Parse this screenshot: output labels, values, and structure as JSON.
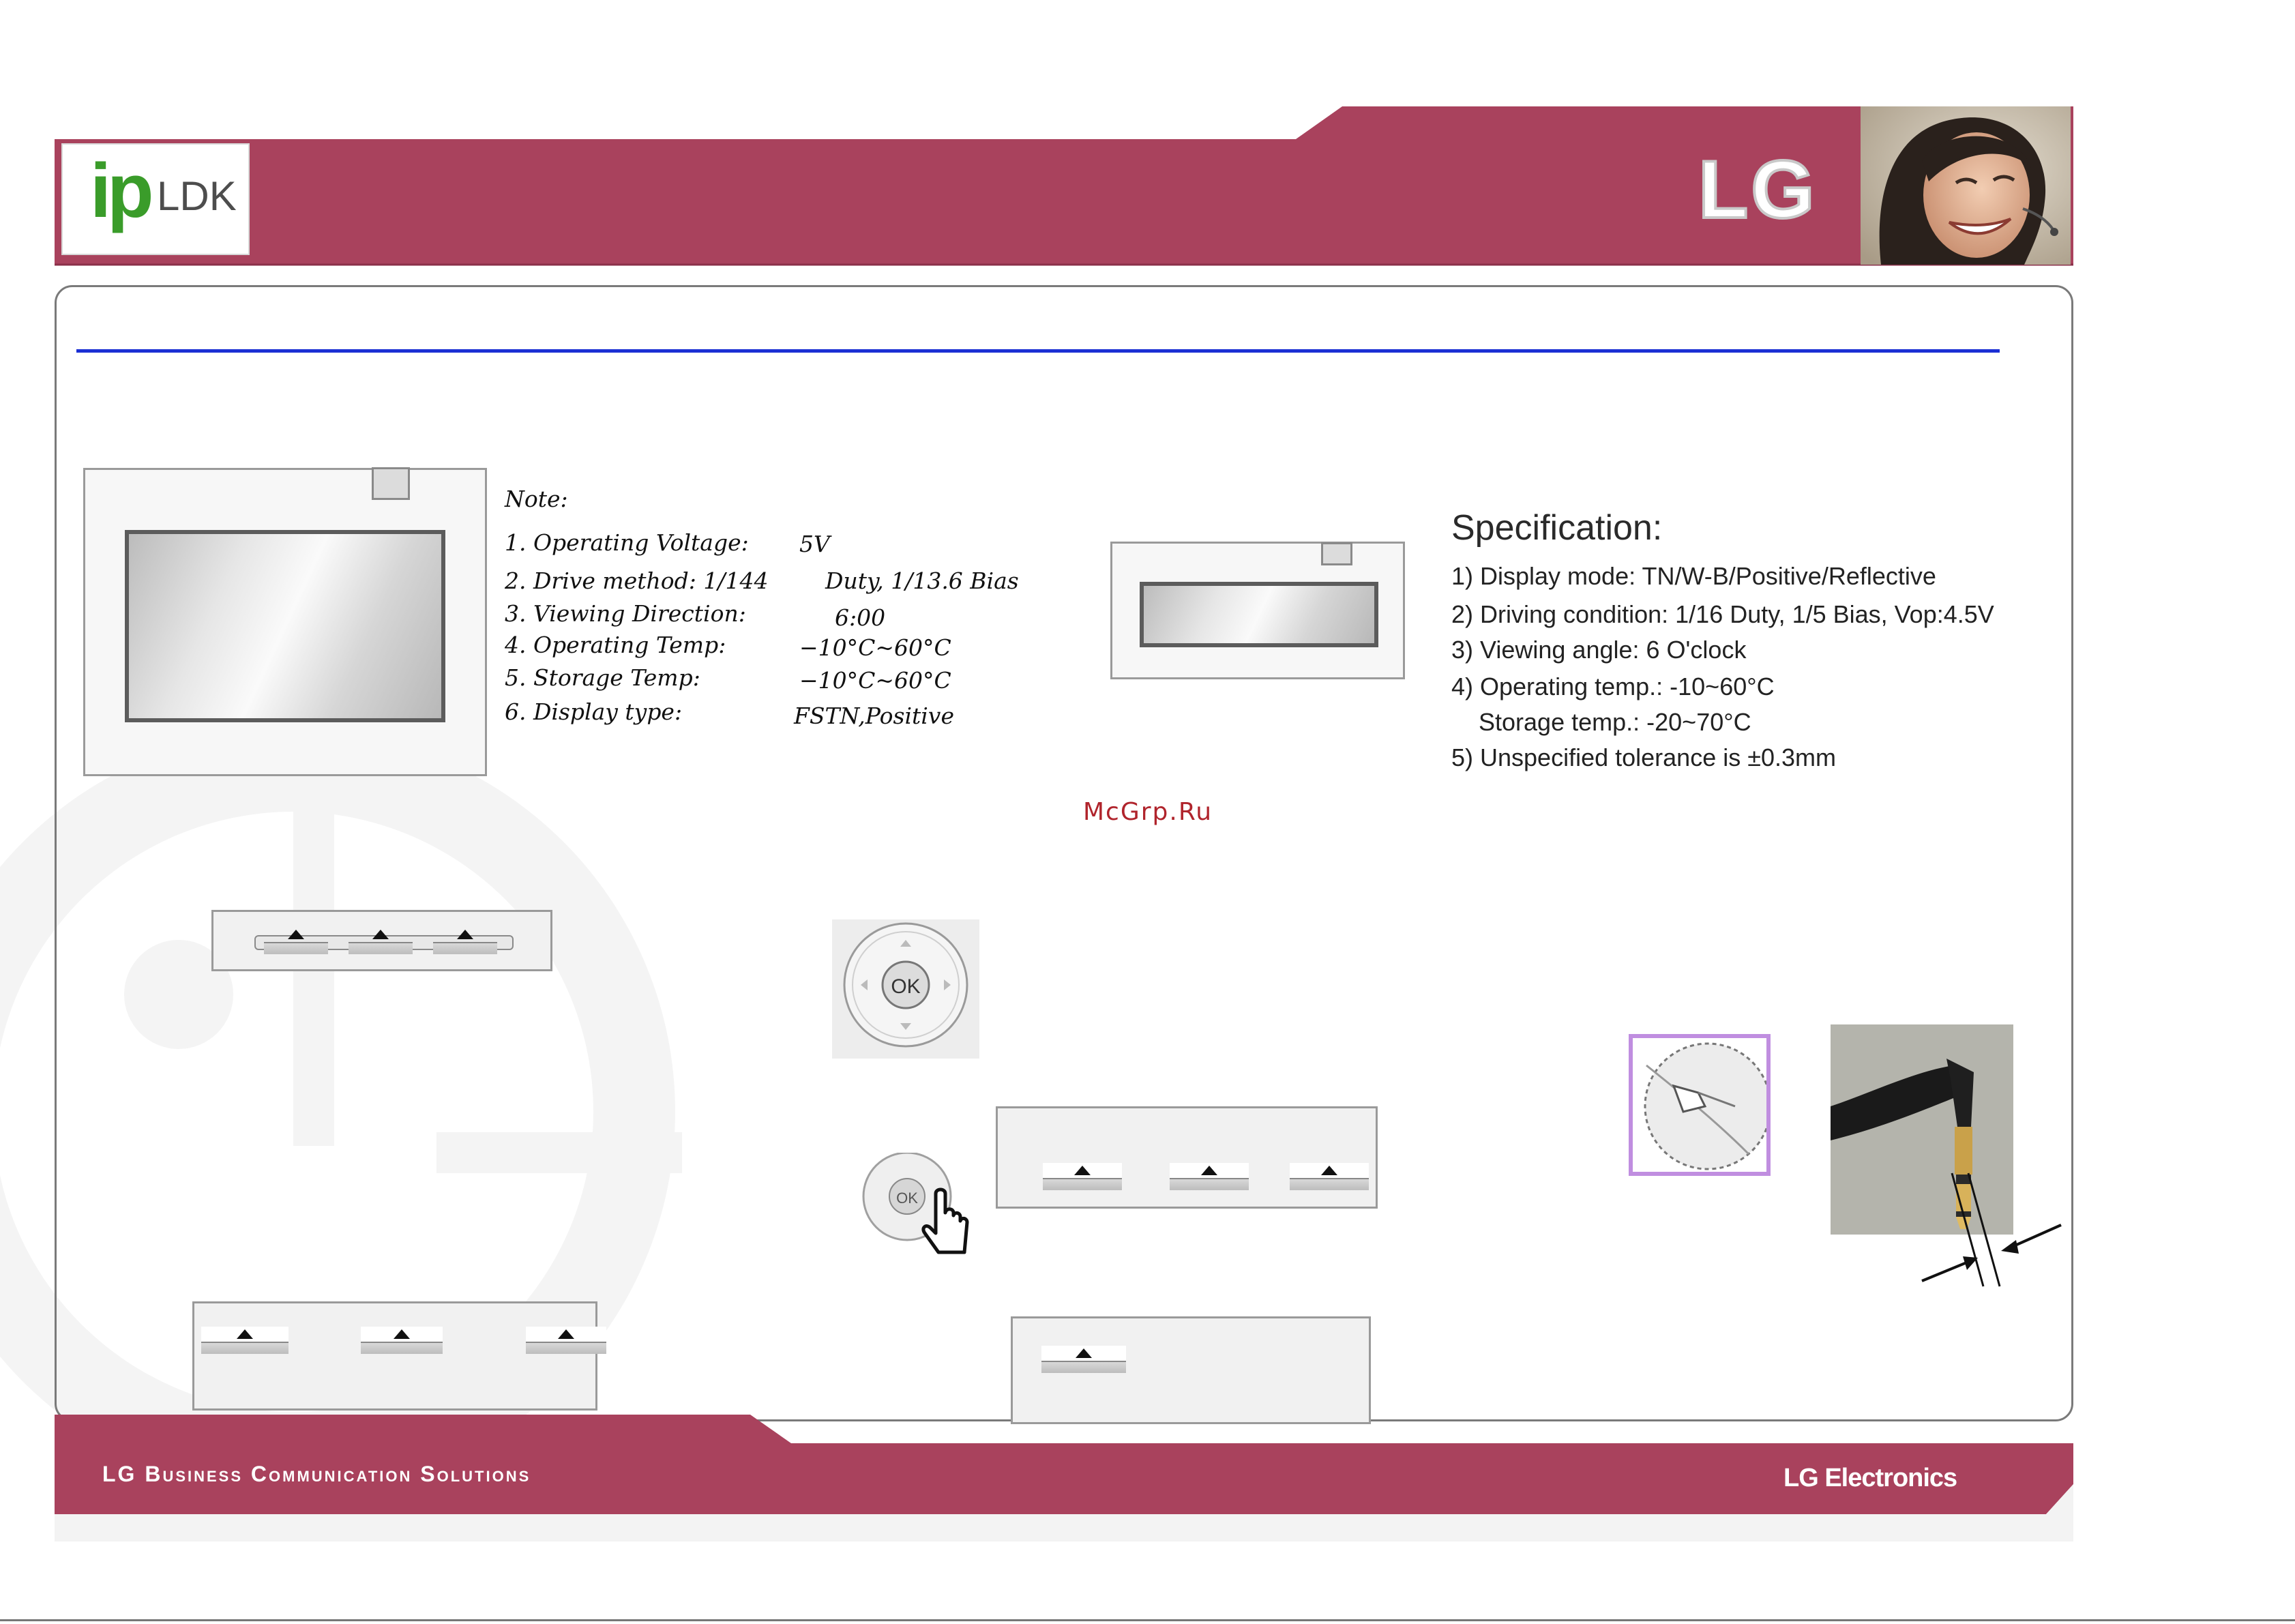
{
  "header": {
    "logo_ip": "ip",
    "logo_ldk": "LDK",
    "brand_mark": "LG",
    "band_color": "#a9425d"
  },
  "note": {
    "heading": "Note:",
    "items": [
      {
        "label": "1.  Operating Voltage:",
        "value": "5V"
      },
      {
        "label": "2.  Drive method:  1/144",
        "value": "Duty,  1/13.6  Bias"
      },
      {
        "label": "3.  Viewing Direction:",
        "value": "6:00"
      },
      {
        "label": "4.  Operating Temp:",
        "value": "−10°C~60°C"
      },
      {
        "label": "5.  Storage Temp:",
        "value": "−10°C~60°C"
      },
      {
        "label": "6.  Display type:",
        "value": "FSTN,Positive"
      }
    ]
  },
  "specification": {
    "title": "Specification:",
    "items": [
      "1) Display mode: TN/W-B/Positive/Reflective",
      "2) Driving condition: 1/16 Duty, 1/5 Bias, Vop:4.5V",
      "3) Viewing angle: 6 O'clock",
      "4) Operating temp.: -10~60°C",
      "    Storage temp.: -20~70°C",
      "5) Unspecified tolerance is ±0.3mm"
    ]
  },
  "watermark": "McGrp.Ru",
  "nav_key": {
    "center_label": "OK",
    "small_center_label": "OK"
  },
  "footer": {
    "left_text": "LG Business Communication Solutions",
    "right_text": "LG Electronics"
  }
}
